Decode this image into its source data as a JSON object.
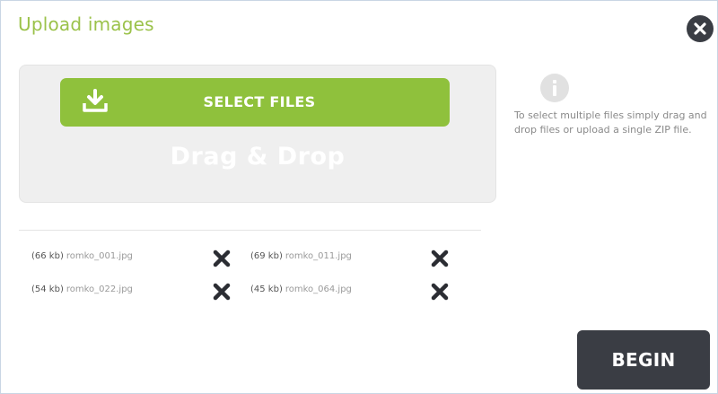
{
  "dialog": {
    "title": "Upload images",
    "close_icon": "close-icon"
  },
  "upload": {
    "select_label": "SELECT FILES",
    "upload_icon": "upload-icon",
    "drag_drop": "Drag & Drop"
  },
  "info": {
    "icon": "info-icon",
    "text": "To select multiple files simply drag and drop files or upload a single ZIP file."
  },
  "files": [
    {
      "size": "(66 kb)",
      "name": "romko_001.jpg"
    },
    {
      "size": "(69 kb)",
      "name": "romko_011.jpg"
    },
    {
      "size": "(54 kb)",
      "name": "romko_022.jpg"
    },
    {
      "size": "(45 kb)",
      "name": "romko_064.jpg"
    }
  ],
  "actions": {
    "begin_label": "BEGIN"
  },
  "colors": {
    "accent_green": "#8fc13c",
    "title_green": "#9bc24a",
    "dark_button": "#3a3d44"
  }
}
